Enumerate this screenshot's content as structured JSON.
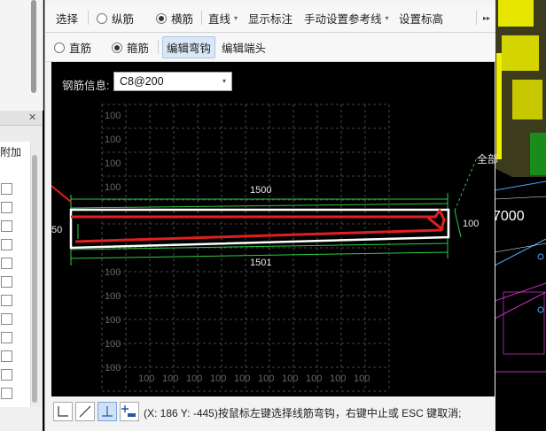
{
  "toolbar1": {
    "select": "选择",
    "radio_longitudinal": "纵筋",
    "radio_transverse": "横筋",
    "line_mode": "直线",
    "show_annotation": "显示标注",
    "manual_reference": "手动设置参考线",
    "set_elevation": "设置标高",
    "more": "▸▸"
  },
  "toolbar2": {
    "radio_straight": "直筋",
    "radio_stirrup": "箍筋",
    "edit_hook": "编辑弯钩",
    "edit_end": "编辑端头"
  },
  "canvas": {
    "rebar_info_label": "钢筋信息:",
    "rebar_info_value": "C8@200",
    "dim_top": "1500",
    "dim_bottom": "1501",
    "dim_right": "100",
    "dim_left_partial": "50",
    "grid_label": "100",
    "bg_label_all": "全部"
  },
  "rightbg": {
    "value": "7000"
  },
  "status": {
    "coords_prompt": "(X: 186 Y: -445)按鼠标左键选择线筋弯钩，右键中止或 ESC 键取消;"
  },
  "leftpanel": {
    "add_label": "附加"
  },
  "colors": {
    "rebar_red": "#e02020",
    "outline_white": "#ffffff",
    "guide_green": "#2ecc40",
    "grid_gray": "#5a5a5a",
    "accent_blue": "#cfe1f6"
  }
}
